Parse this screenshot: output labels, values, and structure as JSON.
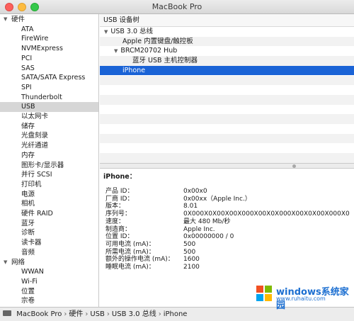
{
  "window": {
    "title": "MacBook Pro"
  },
  "sidebar": {
    "groups": [
      {
        "label": "硬件",
        "expanded": true,
        "items": [
          "ATA",
          "FireWire",
          "NVMExpress",
          "PCI",
          "SAS",
          "SATA/SATA Express",
          "SPI",
          "Thunderbolt",
          "USB",
          "以太网卡",
          "储存",
          "光盘刻录",
          "光纤通道",
          "内存",
          "图形卡/显示器",
          "并行 SCSI",
          "打印机",
          "电源",
          "相机",
          "硬件 RAID",
          "蓝牙",
          "诊断",
          "读卡器",
          "音频"
        ]
      },
      {
        "label": "网络",
        "expanded": true,
        "items": [
          "WWAN",
          "Wi-Fi",
          "位置",
          "宗卷"
        ]
      }
    ],
    "selected": "USB"
  },
  "panel": {
    "title": "USB 设备树"
  },
  "tree": {
    "rows": [
      {
        "label": "USB 3.0 总线",
        "expandable": true,
        "level": 0
      },
      {
        "label": "Apple 内置键盘/触控板",
        "expandable": false,
        "level": 1
      },
      {
        "label": "BRCM20702 Hub",
        "expandable": true,
        "level": 1
      },
      {
        "label": "蓝牙 USB 主机控制器",
        "expandable": false,
        "level": 2
      },
      {
        "label": "iPhone",
        "expandable": false,
        "level": 1
      }
    ],
    "selected_index": 4
  },
  "details": {
    "title": "iPhone：",
    "rows": [
      {
        "label": "产品 ID：",
        "value": "0x00x0"
      },
      {
        "label": "厂商 ID：",
        "value": "0x00xx（Apple Inc.）"
      },
      {
        "label": "版本：",
        "value": "8.01"
      },
      {
        "label": "序列号：",
        "value": "0X000X0X00X00X000X00X0X000X00X0X00X000X0"
      },
      {
        "label": "速度：",
        "value": "最大 480 Mb/秒"
      },
      {
        "label": "制造商：",
        "value": "Apple Inc."
      },
      {
        "label": "位置 ID：",
        "value": "0x00000000 / 0"
      },
      {
        "label": "可用电流 (mA)：",
        "value": "500"
      },
      {
        "label": "所需电流 (mA)：",
        "value": "500"
      },
      {
        "label": "额外的操作电流 (mA)：",
        "value": "1600"
      },
      {
        "label": "睡眠电流 (mA)：",
        "value": "2100"
      }
    ]
  },
  "pathbar": {
    "items": [
      "MacBook Pro",
      "硬件",
      "USB",
      "USB 3.0 总线",
      "iPhone"
    ]
  },
  "watermark": {
    "brand": "windows系统家园",
    "url": "www.ruhaitu.com"
  },
  "colors": {
    "selection": "#1a63d6",
    "sidebar_selection": "#d6d6d6",
    "red_light": "#fc605c",
    "yellow_light": "#fdbc40",
    "green_light": "#34c84a"
  }
}
